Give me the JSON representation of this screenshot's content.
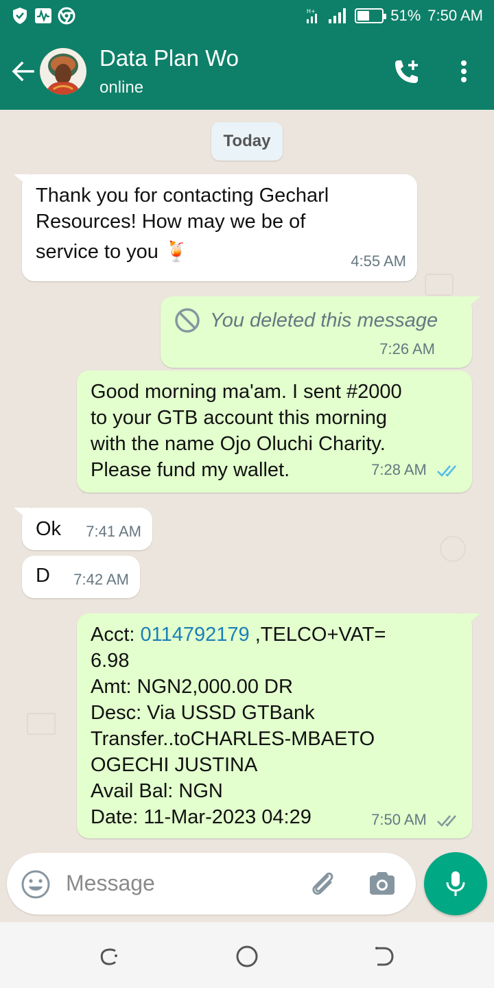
{
  "status_bar": {
    "battery_percent": "51%",
    "battery_level": 0.51,
    "time": "7:50 AM",
    "icons": [
      "shield-icon",
      "activity-icon",
      "chrome-icon",
      "hd-signal-icon",
      "signal-icon",
      "battery-icon"
    ]
  },
  "header": {
    "title": "Data Plan Wo",
    "subtitle": "online",
    "icons": [
      "back-arrow-icon",
      "add-call-icon",
      "more-vert-icon"
    ]
  },
  "chat": {
    "date_divider": "Today",
    "messages": [
      {
        "direction": "incoming",
        "text_lines": [
          "Thank you for contacting Gecharl",
          "Resources! How may we be of",
          "service to you 🍹"
        ],
        "time": "4:55 AM"
      },
      {
        "direction": "outgoing",
        "deleted": true,
        "text": "You deleted this message",
        "time": "7:26 AM"
      },
      {
        "direction": "outgoing",
        "text_lines": [
          "Good morning ma'am. I sent #2000",
          "to your GTB account this morning",
          "with the name Ojo Oluchi Charity.",
          "Please fund my wallet."
        ],
        "time": "7:28 AM",
        "status": "read"
      },
      {
        "direction": "incoming",
        "text": "Ok",
        "time": "7:41 AM"
      },
      {
        "direction": "incoming",
        "text": "D",
        "time": "7:42 AM"
      },
      {
        "direction": "outgoing",
        "acct_prefix": "Acct: ",
        "acct_number": "0114792179",
        "acct_suffix": " ,TELCO+VAT=",
        "text_lines": [
          "6.98",
          "Amt: NGN2,000.00 DR",
          "Desc: Via USSD GTBank",
          "Transfer..toCHARLES-MBAETO",
          "OGECHI JUSTINA",
          "Avail Bal: NGN",
          "Date: 11-Mar-2023 04:29"
        ],
        "time": "7:50 AM",
        "status": "delivered"
      }
    ]
  },
  "composer": {
    "placeholder": "Message",
    "icons": [
      "emoji-icon",
      "attach-icon",
      "camera-icon",
      "mic-icon"
    ]
  },
  "nav_bar": {
    "icons": [
      "recents-icon",
      "home-icon",
      "back-icon"
    ]
  },
  "colors": {
    "header": "#0E8069",
    "chat_bg": "#ECE5DD",
    "incoming_bubble": "#FFFFFF",
    "outgoing_bubble": "#E2FFCD",
    "read_ticks": "#53BDEB",
    "accent": "#00A884"
  }
}
